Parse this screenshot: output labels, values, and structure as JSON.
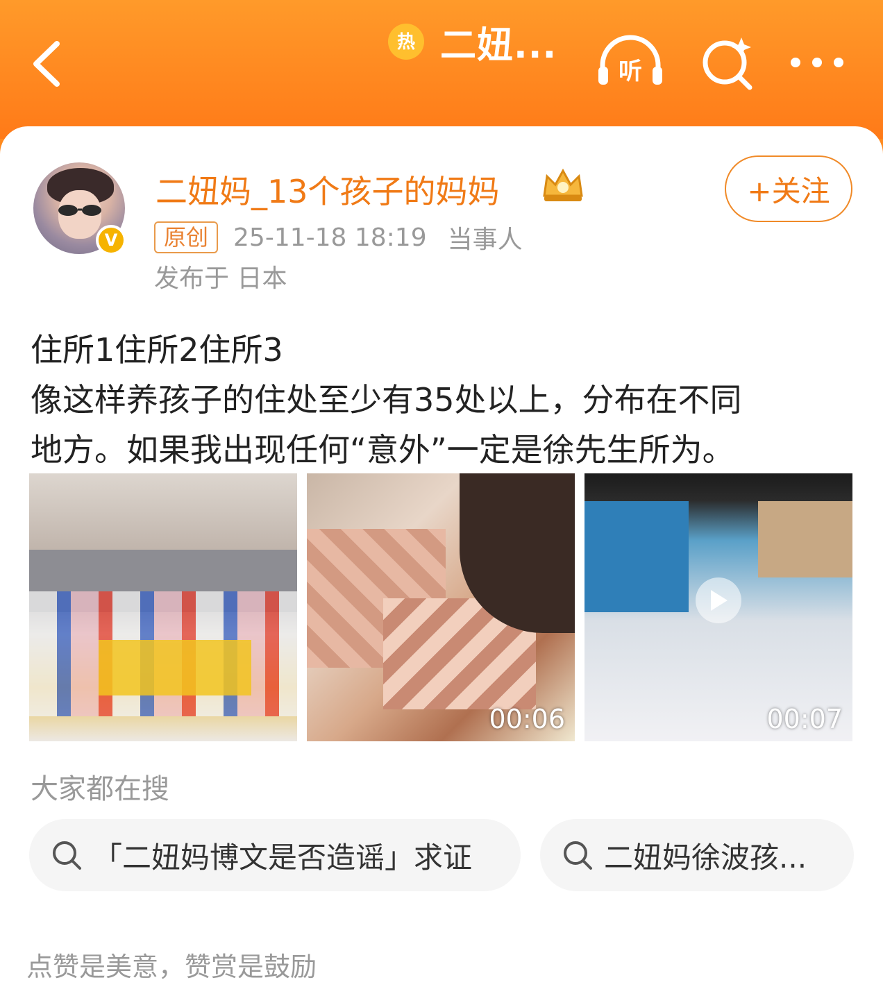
{
  "header": {
    "title": "二妞...",
    "hot_badge_label": "热",
    "listen_label": "听",
    "back_icon": "chevron-left-icon",
    "listen_icon": "headphones-icon",
    "search_icon": "search-sparkle-icon",
    "more_icon": "more-dots-icon",
    "background_color": "#ff7a18"
  },
  "post": {
    "author_name": "二妞妈_13个孩子的妈妈",
    "verified_badge": "V",
    "follow_label": "+关注",
    "original_tag": "原创",
    "timestamp": "25-11-18 18:19",
    "role": "当事人",
    "location": "发布于 日本",
    "text_lines": [
      "住所1住所2住所3",
      "像这样养孩子的住处至少有35处以上，分布在不同",
      "地方。如果我出现任何“意外”一定是徐先生所为。"
    ],
    "media": [
      {
        "type": "image"
      },
      {
        "type": "video",
        "duration": "00:06"
      },
      {
        "type": "video",
        "duration": "00:07"
      }
    ]
  },
  "search_section": {
    "title": "大家都在搜",
    "chips": [
      "「二妞妈博文是否造谣」求证",
      "二妞妈徐波孩..."
    ]
  },
  "footer_note": "点赞是美意，赞赏是鼓励",
  "colors": {
    "accent": "#f07a16",
    "muted": "#999999"
  }
}
